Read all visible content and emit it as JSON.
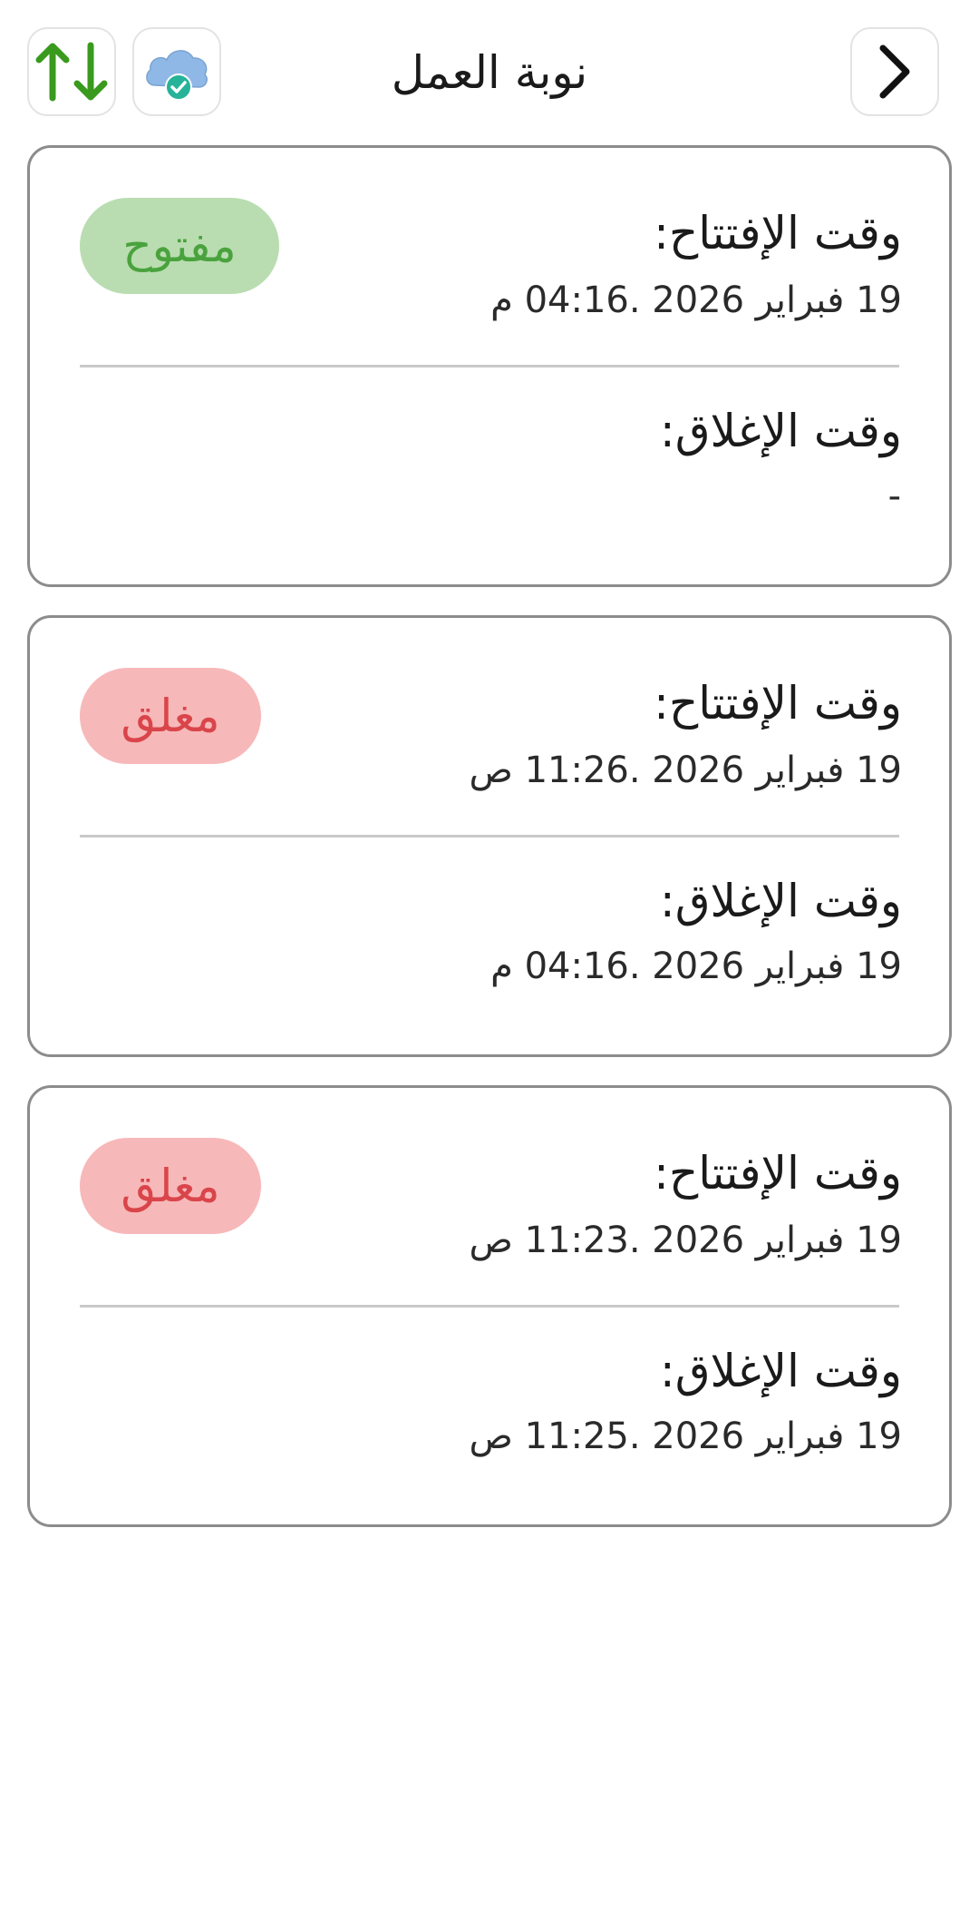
{
  "header": {
    "title": "نوبة العمل",
    "sort_icon": "sort-arrows-icon",
    "sync_icon": "cloud-synced-icon",
    "back_icon": "chevron-right-icon"
  },
  "colors": {
    "open_badge_bg": "#b9ddb1",
    "open_badge_text": "#4aa23d",
    "closed_badge_bg": "#f7b8b9",
    "closed_badge_text": "#d9454a",
    "sort_arrows": "#3a9a1e",
    "cloud": "#8fb8e6",
    "check": "#26b39a"
  },
  "shifts": [
    {
      "status": "مفتوح",
      "open_label": "وقت الإفتتاح:",
      "open_time": "19 فبراير 2026 .04:16 م",
      "close_label": "وقت الإغلاق:",
      "close_time": "-"
    },
    {
      "status": "مغلق",
      "open_label": "وقت الإفتتاح:",
      "open_time": "19 فبراير 2026 .11:26 ص",
      "close_label": "وقت الإغلاق:",
      "close_time": "19 فبراير 2026 .04:16 م"
    },
    {
      "status": "مغلق",
      "open_label": "وقت الإفتتاح:",
      "open_time": "19 فبراير 2026 .11:23 ص",
      "close_label": "وقت الإغلاق:",
      "close_time": "19 فبراير 2026 .11:25 ص"
    }
  ]
}
